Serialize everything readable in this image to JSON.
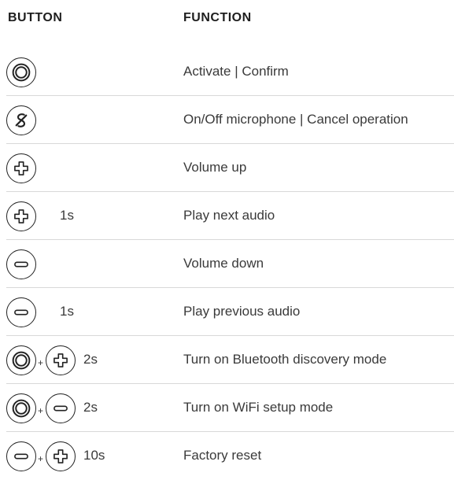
{
  "headers": {
    "button": "BUTTON",
    "function": "FUNCTION"
  },
  "rows": [
    {
      "function": "Activate | Confirm",
      "duration": "",
      "plus": ""
    },
    {
      "function": "On/Off microphone | Cancel operation",
      "duration": "",
      "plus": ""
    },
    {
      "function": "Volume up",
      "duration": "",
      "plus": ""
    },
    {
      "function": "Play next audio",
      "duration": "1s",
      "plus": ""
    },
    {
      "function": "Volume down",
      "duration": "",
      "plus": ""
    },
    {
      "function": "Play previous audio",
      "duration": "1s",
      "plus": ""
    },
    {
      "function": "Turn on Bluetooth discovery mode",
      "duration": "2s",
      "plus": "+"
    },
    {
      "function": "Turn on WiFi setup mode",
      "duration": "2s",
      "plus": "+"
    },
    {
      "function": "Factory reset",
      "duration": "10s",
      "plus": "+"
    }
  ],
  "icons": {
    "action": "action-button-icon",
    "mic": "mic-off-button-icon",
    "plus": "volume-up-button-icon",
    "minus": "volume-down-button-icon"
  }
}
